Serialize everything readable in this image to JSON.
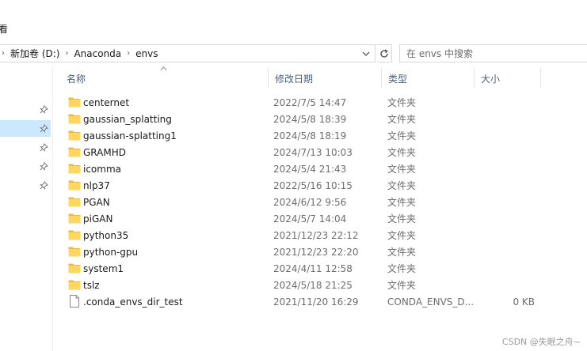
{
  "ribbon": {
    "visible_tab_fragment": "看"
  },
  "address": {
    "crumbs": [
      "新加卷 (D:)",
      "Anaconda",
      "envs"
    ]
  },
  "search": {
    "placeholder": "在 envs 中搜索"
  },
  "columns": {
    "name": "名称",
    "date": "修改日期",
    "type": "类型",
    "size": "大小"
  },
  "files": [
    {
      "name": "centernet",
      "date": "2022/7/5 14:47",
      "type": "文件夹",
      "size": "",
      "kind": "folder"
    },
    {
      "name": "gaussian_splatting",
      "date": "2024/5/8 18:39",
      "type": "文件夹",
      "size": "",
      "kind": "folder"
    },
    {
      "name": "gaussian-splatting1",
      "date": "2024/5/8 18:19",
      "type": "文件夹",
      "size": "",
      "kind": "folder"
    },
    {
      "name": "GRAMHD",
      "date": "2024/7/13 10:03",
      "type": "文件夹",
      "size": "",
      "kind": "folder"
    },
    {
      "name": "icomma",
      "date": "2024/5/4 21:43",
      "type": "文件夹",
      "size": "",
      "kind": "folder"
    },
    {
      "name": "nlp37",
      "date": "2022/5/16 10:15",
      "type": "文件夹",
      "size": "",
      "kind": "folder"
    },
    {
      "name": "PGAN",
      "date": "2024/6/12 9:56",
      "type": "文件夹",
      "size": "",
      "kind": "folder"
    },
    {
      "name": "piGAN",
      "date": "2024/5/7 14:04",
      "type": "文件夹",
      "size": "",
      "kind": "folder"
    },
    {
      "name": "python35",
      "date": "2021/12/23 22:12",
      "type": "文件夹",
      "size": "",
      "kind": "folder"
    },
    {
      "name": "python-gpu",
      "date": "2021/12/23 22:20",
      "type": "文件夹",
      "size": "",
      "kind": "folder"
    },
    {
      "name": "system1",
      "date": "2024/4/11 12:58",
      "type": "文件夹",
      "size": "",
      "kind": "folder"
    },
    {
      "name": "tslz",
      "date": "2024/5/18 21:25",
      "type": "文件夹",
      "size": "",
      "kind": "folder"
    },
    {
      "name": ".conda_envs_dir_test",
      "date": "2021/11/20 16:29",
      "type": "CONDA_ENVS_D...",
      "size": "0 KB",
      "kind": "file"
    }
  ],
  "watermark": "CSDN @失眠之舟~",
  "colors": {
    "folder_fill": "#ffd75e",
    "folder_tab": "#e8b84a",
    "selection": "#cce8ff",
    "header_text": "#4c607a"
  }
}
